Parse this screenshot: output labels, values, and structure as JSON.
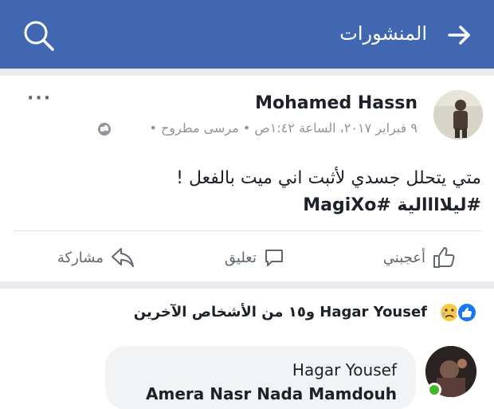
{
  "header": {
    "title": "المنشورات",
    "back_icon": "arrow-right-icon",
    "search_icon": "search-icon"
  },
  "post": {
    "author": "Mohamed Hassn",
    "meta": "٩ فبراير ٢٠١٧، الساعة ١:٤٢ص • مرسى مطروح •",
    "text_line1": "متي يتحلل جسدي لأثبت اني ميت بالفعل !",
    "hashtags": "#ليلاااالية #MagiXo",
    "actions": {
      "like": "أعجبني",
      "comment": "تعليق",
      "share": "مشاركة"
    }
  },
  "reactions": {
    "summary": "Hagar Yousef و١٥ من الأشخاص الآخرين"
  },
  "comment": {
    "name": "Hagar Yousef",
    "text": "Amera Nasr Nada Mamdouh"
  },
  "colors": {
    "header_bg": "#4267b2",
    "online": "#42b72a",
    "like_blue": "#1877f2"
  }
}
